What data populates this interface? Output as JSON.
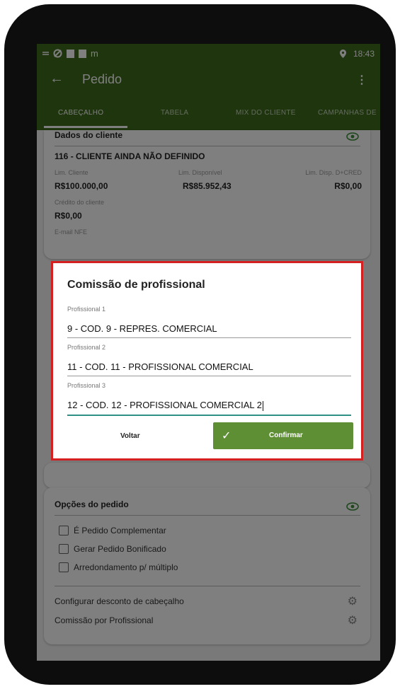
{
  "status_bar": {
    "left_glyph": "m",
    "time": "18:43"
  },
  "toolbar": {
    "back_icon": "arrow-left-icon",
    "title": "Pedido",
    "menu_icon": "more-vert-icon"
  },
  "tabs": [
    "CABEÇALHO",
    "TABELA",
    "MIX DO CLIENTE",
    "CAMPANHAS DE"
  ],
  "client_card": {
    "title": "Dados do cliente",
    "client_name": "116 - CLIENTE AINDA NÃO DEFINIDO",
    "lim_cliente_label": "Lim. Cliente",
    "lim_cliente_value": "R$100.000,00",
    "lim_disponivel_label": "Lim. Disponível",
    "lim_disponivel_value": "R$85.952,43",
    "lim_disp_cred_label": "Lim. Disp. D+CRED",
    "lim_disp_cred_value": "R$0,00",
    "credito_label": "Crédito do cliente",
    "credito_value": "R$0,00",
    "email_label": "E-mail NFE"
  },
  "options_card": {
    "title": "Opções do pedido",
    "checkboxes": [
      "É Pedido Complementar",
      "Gerar Pedido Bonificado",
      "Arredondamento p/ múltiplo"
    ],
    "settings": [
      "Configurar desconto de cabeçalho",
      "Comissão por Profissional"
    ]
  },
  "dialog": {
    "title": "Comissão de profissional",
    "fields": [
      {
        "label": "Profissional 1",
        "value": "9 - COD. 9 - REPRES. COMERCIAL"
      },
      {
        "label": "Profissional 2",
        "value": "11 - COD. 11 - PROFISSIONAL COMERCIAL"
      },
      {
        "label": "Profissional 3",
        "value": "12 - COD. 12 - PROFISSIONAL COMERCIAL 2"
      }
    ],
    "cancel_label": "Voltar",
    "confirm_label": "Confirmar"
  },
  "colors": {
    "appbar": "#3d6a1c",
    "accent": "#5e8f34",
    "dialog_border": "#d42020",
    "eye_icon": "#3f8f3a"
  }
}
